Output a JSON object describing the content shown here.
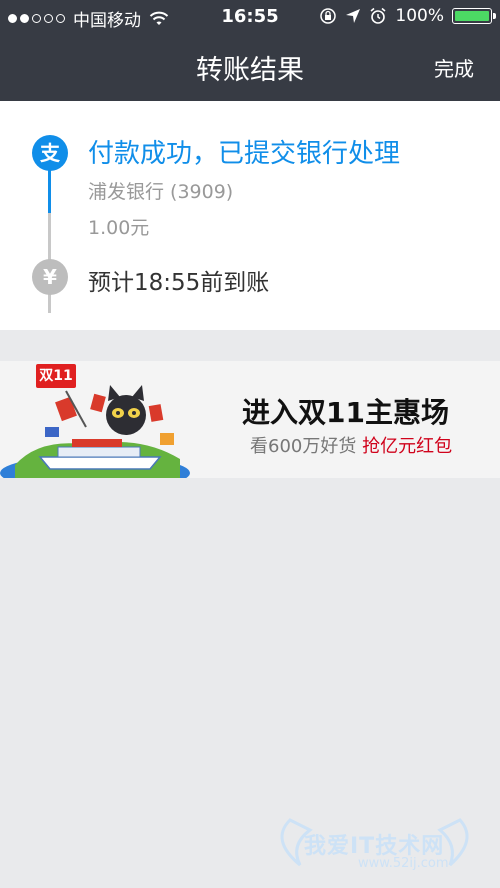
{
  "status_bar": {
    "carrier": "中国移动",
    "time": "16:55",
    "battery": "100%",
    "battery_level": 1.0
  },
  "nav": {
    "title": "转账结果",
    "done_label": "完成"
  },
  "result": {
    "pay_icon_glyph": "支",
    "status": "付款成功，已提交银行处理",
    "bank": "浦发银行 (3909)",
    "amount": "1.00元",
    "yen_icon_glyph": "¥",
    "eta": "预计18:55前到账"
  },
  "banner": {
    "tag": "双11",
    "headline": "进入双11主惠场",
    "sub_prefix": "看600万好货 ",
    "sub_highlight": "抢亿元红包"
  },
  "watermark": {
    "text": "我爱IT技术网",
    "url": "www.52ij.com"
  },
  "colors": {
    "nav_bg": "#373b44",
    "accent": "#108ee9",
    "page_bg": "#e9eaec",
    "promo_red": "#d0021b"
  }
}
